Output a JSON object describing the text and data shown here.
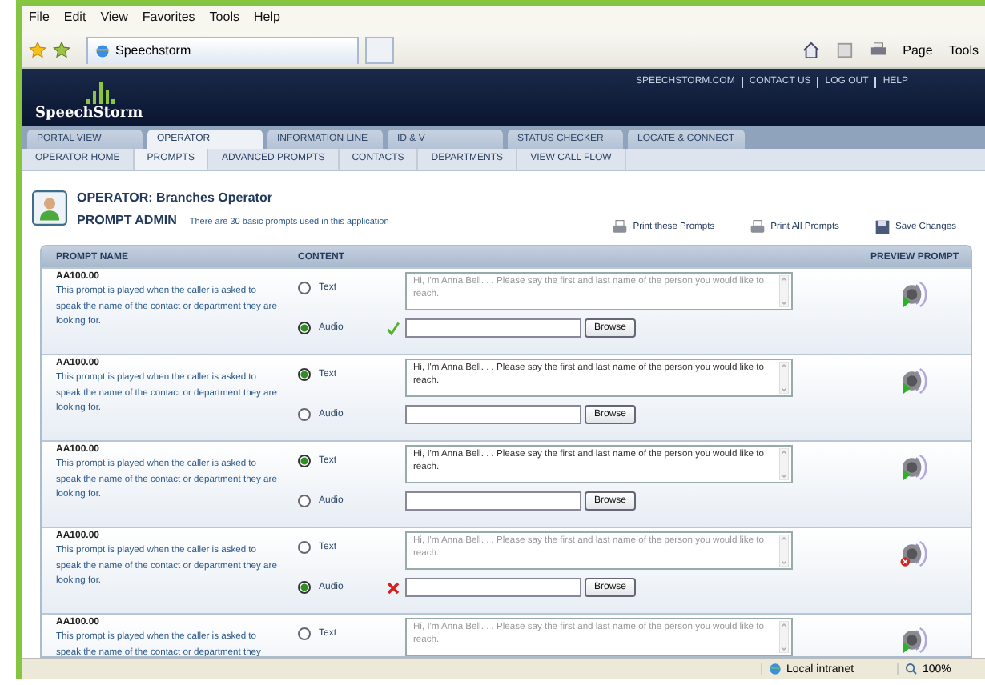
{
  "menu": [
    "File",
    "Edit",
    "View",
    "Favorites",
    "Tools",
    "Help"
  ],
  "browser_tab": {
    "title": "Speechstorm"
  },
  "toolbar": {
    "page": "Page",
    "tools": "Tools"
  },
  "header": {
    "logo": "SpeechStorm",
    "links": [
      "SPEECHSTORM.COM",
      "CONTACT US",
      "LOG OUT",
      "HELP"
    ]
  },
  "tabs": [
    {
      "label": "PORTAL VIEW",
      "selected": false
    },
    {
      "label": "OPERATOR",
      "selected": true
    },
    {
      "label": "INFORMATION LINE",
      "selected": false
    },
    {
      "label": "ID & V",
      "selected": false
    },
    {
      "label": "STATUS CHECKER",
      "selected": false
    },
    {
      "label": "LOCATE & CONNECT",
      "selected": false
    }
  ],
  "subnav": [
    {
      "label": "OPERATOR HOME",
      "selected": false
    },
    {
      "label": "PROMPTS",
      "selected": true
    },
    {
      "label": "ADVANCED PROMPTS",
      "selected": false
    },
    {
      "label": "CONTACTS",
      "selected": false
    },
    {
      "label": "DEPARTMENTS",
      "selected": false
    },
    {
      "label": "VIEW CALL FLOW",
      "selected": false
    }
  ],
  "page_header": {
    "title": "OPERATOR: Branches Operator",
    "subtitle": "PROMPT ADMIN",
    "note": "There are 30 basic prompts used in this application"
  },
  "actions": [
    {
      "label": "Print these Prompts",
      "kind": "print"
    },
    {
      "label": "Print All Prompts",
      "kind": "print"
    },
    {
      "label": "Save Changes",
      "kind": "save"
    }
  ],
  "table": {
    "columns": [
      "PROMPT NAME",
      "CONTENT",
      "PREVIEW PROMPT"
    ],
    "rows": [
      {
        "name": "AA100.00",
        "description": "This prompt is played when the caller is asked to speak the name of the contact or department they are looking for.",
        "text": {
          "label": "Text",
          "selected": false,
          "value": "Hi, I'm Anna Bell. . . Please say the first and last name of the person you would like to reach."
        },
        "audio": {
          "label": "Audio",
          "selected": true,
          "verified": true,
          "failed": false,
          "button": "Browse"
        },
        "preview_error": false
      },
      {
        "name": "AA100.00",
        "description": "This prompt is played when the caller is asked to speak the name of the contact or department they are looking for.",
        "text": {
          "label": "Text",
          "selected": true,
          "value": "Hi, I'm Anna Bell. . . Please say the first and last name of the person you would like to reach."
        },
        "audio": {
          "label": "Audio",
          "selected": false,
          "verified": false,
          "failed": false,
          "button": "Browse"
        },
        "preview_error": false
      },
      {
        "name": "AA100.00",
        "description": "This prompt is played when the caller is asked to speak the name of the contact or department they are looking for.",
        "text": {
          "label": "Text",
          "selected": true,
          "value": "Hi, I'm Anna Bell. . . Please say the first and last name of the person you would like to reach."
        },
        "audio": {
          "label": "Audio",
          "selected": false,
          "verified": false,
          "failed": false,
          "button": "Browse"
        },
        "preview_error": false
      },
      {
        "name": "AA100.00",
        "description": "This prompt is played when the caller is asked to speak the name of the contact or department they are looking for.",
        "text": {
          "label": "Text",
          "selected": false,
          "value": "Hi, I'm Anna Bell. . . Please say the first and last name of the person you would like to reach."
        },
        "audio": {
          "label": "Audio",
          "selected": true,
          "verified": false,
          "failed": true,
          "button": "Browse"
        },
        "preview_error": true
      },
      {
        "name": "AA100.00",
        "description": "This prompt is played when the caller is asked to speak the name of the contact or department they",
        "text": {
          "label": "Text",
          "selected": false,
          "value": "Hi, I'm Anna Bell. . . Please say the first and last name of the person you would like to reach."
        },
        "preview_error": false
      }
    ]
  },
  "status_bar": {
    "zone": "Local intranet",
    "zoom": "100%"
  }
}
